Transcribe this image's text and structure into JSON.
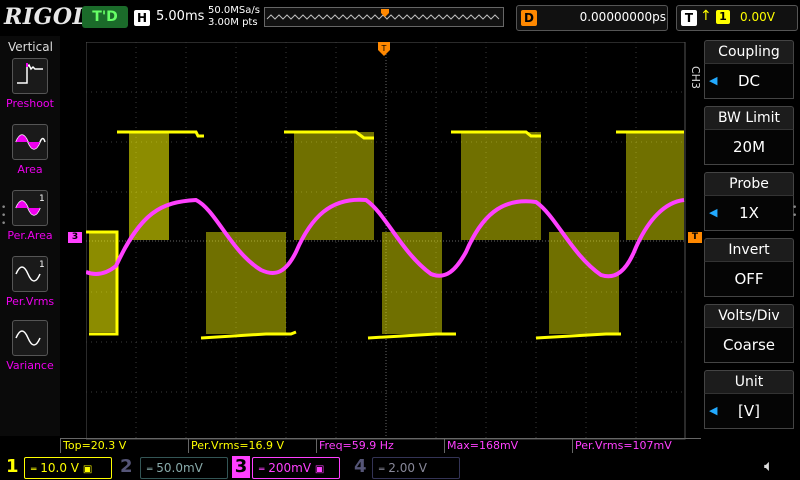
{
  "brand": "RIGOL",
  "top": {
    "trigger_status": "T'D",
    "h_tag": "H",
    "timebase": "5.00ms",
    "sample_rate": "50.0MSa/s",
    "memory_depth": "3.00M pts",
    "delay_tag": "D",
    "delay_value": "0.00000000ps",
    "trig_tag": "T",
    "trig_source": "1",
    "trig_level": "0.00V"
  },
  "left_menu": {
    "title": "Vertical",
    "items": [
      {
        "label": "Preshoot"
      },
      {
        "label": "Area"
      },
      {
        "label": "Per.Area"
      },
      {
        "label": "Per.Vrms"
      },
      {
        "label": "Variance"
      }
    ]
  },
  "right_menu": {
    "channel_label": "CH3",
    "groups": [
      {
        "title": "Coupling",
        "value": "DC"
      },
      {
        "title": "BW Limit",
        "value": "20M"
      },
      {
        "title": "Probe",
        "value": "1X"
      },
      {
        "title": "Invert",
        "value": "OFF"
      },
      {
        "title": "Volts/Div",
        "value": "Coarse"
      },
      {
        "title": "Unit",
        "value": "[V]"
      }
    ]
  },
  "markers": {
    "ch3_left": "3",
    "trig_top": "T",
    "trig_right": "T"
  },
  "measurements": [
    {
      "text": "Top=20.3 V",
      "color": "#ffff00"
    },
    {
      "text": "Per.Vrms=16.9 V",
      "color": "#ffff00"
    },
    {
      "text": "Freq=59.9 Hz",
      "color": "#ff40ff"
    },
    {
      "text": "Max=168mV",
      "color": "#ff40ff"
    },
    {
      "text": "Per.Vrms=107mV",
      "color": "#ff40ff"
    }
  ],
  "channels": [
    {
      "num": "1",
      "scale": "10.0 V",
      "color": "#ffff00",
      "active": true
    },
    {
      "num": "2",
      "scale": "50.0mV",
      "color": "#20c0e0",
      "active": false
    },
    {
      "num": "3",
      "scale": "200mV",
      "color": "#ff40ff",
      "active": true
    },
    {
      "num": "4",
      "scale": "2.00 V",
      "color": "#4060ff",
      "active": false
    }
  ],
  "colors": {
    "ch1": "#ffff00",
    "ch3": "#ff40ff",
    "trigger": "#ff8800",
    "grid": "#3a3a3a"
  }
}
